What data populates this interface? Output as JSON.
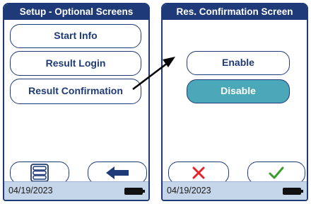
{
  "left_screen": {
    "title": "Setup - Optional Screens",
    "buttons": [
      {
        "label": "Start Info"
      },
      {
        "label": "Result Login"
      },
      {
        "label": "Result Confirmation"
      }
    ],
    "footer": {
      "date": "04/19/2023"
    },
    "icons": {
      "menu": "list-menu-icon",
      "back": "back-arrow-icon",
      "battery": "battery-icon"
    }
  },
  "right_screen": {
    "title": "Res. Confirmation Screen",
    "options": [
      {
        "label": "Enable",
        "selected": false
      },
      {
        "label": "Disable",
        "selected": true
      }
    ],
    "footer": {
      "date": "04/19/2023"
    },
    "icons": {
      "cancel": "cancel-x-icon",
      "confirm": "check-icon",
      "battery": "battery-icon"
    }
  },
  "colors": {
    "header": "#1f3a78",
    "selected": "#4aa8b8",
    "footer": "#c6d6ea",
    "cancel": "#e0262b",
    "confirm": "#3a9b2e"
  },
  "annotation": {
    "arrow": "callout-arrow"
  }
}
